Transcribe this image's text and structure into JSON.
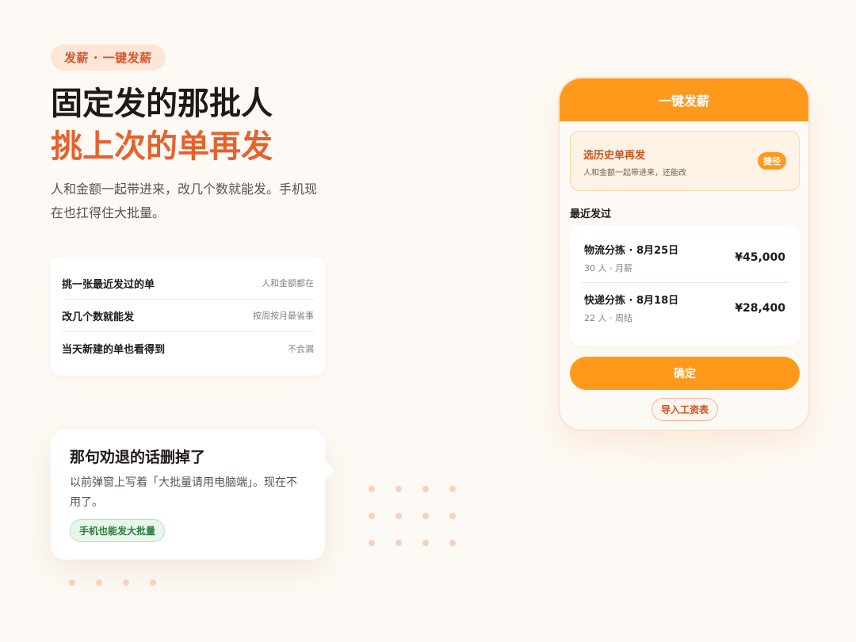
{
  "hero": {
    "badge": "发薪 · 一键发薪",
    "title_line1": "固定发的那批人",
    "title_line2": "挑上次的单再发",
    "description": "人和金额一起带进来，改几个数就能发。手机现在也扛得住大批量。"
  },
  "features": [
    {
      "title": "挑一张最近发过的单",
      "note": "人和金额都在"
    },
    {
      "title": "改几个数就能发",
      "note": "按周按月最省事"
    },
    {
      "title": "当天新建的单也看得到",
      "note": "不会漏"
    }
  ],
  "bubble": {
    "title": "那句劝退的话删掉了",
    "text": "以前弹窗上写着「大批量请用电脑端」。现在不用了。",
    "tag": "手机也能发大批量"
  },
  "phone": {
    "header": "一键发薪",
    "history": {
      "title": "选历史单再发",
      "subtitle": "人和金额一起带进来，还能改",
      "shortcut": "捷径"
    },
    "recent_label": "最近发过",
    "recent": [
      {
        "name": "物流分拣 · 8月25日",
        "meta": "30 人 · 月薪",
        "amount": "¥45,000"
      },
      {
        "name": "快递分拣 · 8月18日",
        "meta": "22 人 · 周结",
        "amount": "¥28,400"
      }
    ],
    "confirm": "确定",
    "import": "导入工资表"
  },
  "colors": {
    "accent": "#ff991c",
    "headline_accent": "#e8602c",
    "badge_text": "#d9552a",
    "tag_green": "#2f7a3e",
    "background": "#fdfaf5"
  }
}
